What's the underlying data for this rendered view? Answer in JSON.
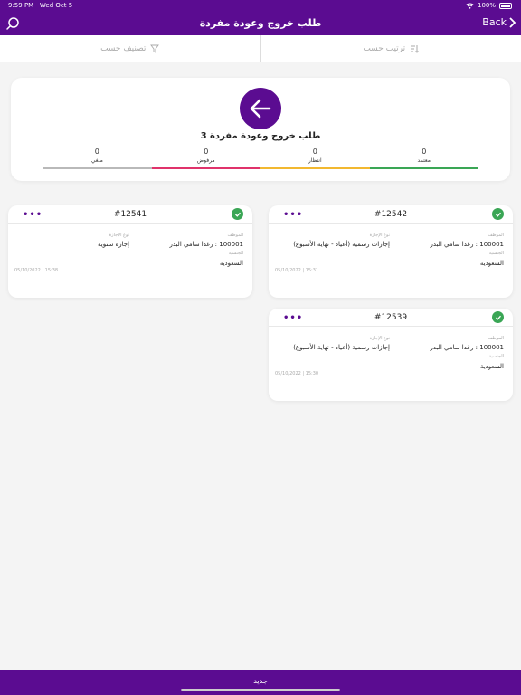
{
  "status": {
    "time": "9:59 PM",
    "date": "Wed Oct 5",
    "battery": "100%"
  },
  "nav": {
    "title": "طلب خروج وعودة مفردة",
    "back_label": "Back"
  },
  "filters": {
    "sort_label": "ترتيب حسب",
    "classify_label": "تصنيف حسب"
  },
  "summary": {
    "title": "3 طلب خروج وعودة مفردة",
    "stats": [
      {
        "label": "معتمد",
        "count": "0",
        "color": "#3aa655"
      },
      {
        "label": "انتظار",
        "count": "0",
        "color": "#f2b830"
      },
      {
        "label": "مرفوض",
        "count": "0",
        "color": "#e0336b"
      },
      {
        "label": "ملغي",
        "count": "0",
        "color": "#b9b9b9"
      }
    ]
  },
  "requests": [
    {
      "id": "#12542",
      "employee_label": "الموظف",
      "employee": "100001 : رغدا سامي البدر",
      "leave_type_label": "نوع الإجازة",
      "leave_type": "إجازات رسمية (أعياد - نهاية الأسبوع)",
      "nationality_label": "الجنسية",
      "nationality": "السعودية",
      "date": "05/10/2022 | 15:31"
    },
    {
      "id": "#12541",
      "employee_label": "الموظف",
      "employee": "100001 : رغدا سامي البدر",
      "leave_type_label": "نوع الإجازة",
      "leave_type": "إجازة سنوية",
      "nationality_label": "الجنسية",
      "nationality": "السعودية",
      "date": "05/10/2022 | 15:38"
    },
    {
      "id": "#12539",
      "employee_label": "الموظف",
      "employee": "100001 : رغدا سامي البدر",
      "leave_type_label": "نوع الإجازة",
      "leave_type": "إجازات رسمية (أعياد - نهاية الأسبوع)",
      "nationality_label": "الجنسية",
      "nationality": "السعودية",
      "date": "05/10/2022 | 15:30"
    }
  ],
  "bottom": {
    "new_label": "جديد"
  },
  "icons": {
    "search": "search-icon",
    "back": "chevron-left-icon",
    "sort": "sort-icon",
    "filter": "filter-icon",
    "arrow": "arrow-left-icon",
    "check": "check-icon",
    "more": "more-dots-icon"
  },
  "colors": {
    "brand": "#5b0c91",
    "approved": "#3aa655"
  }
}
